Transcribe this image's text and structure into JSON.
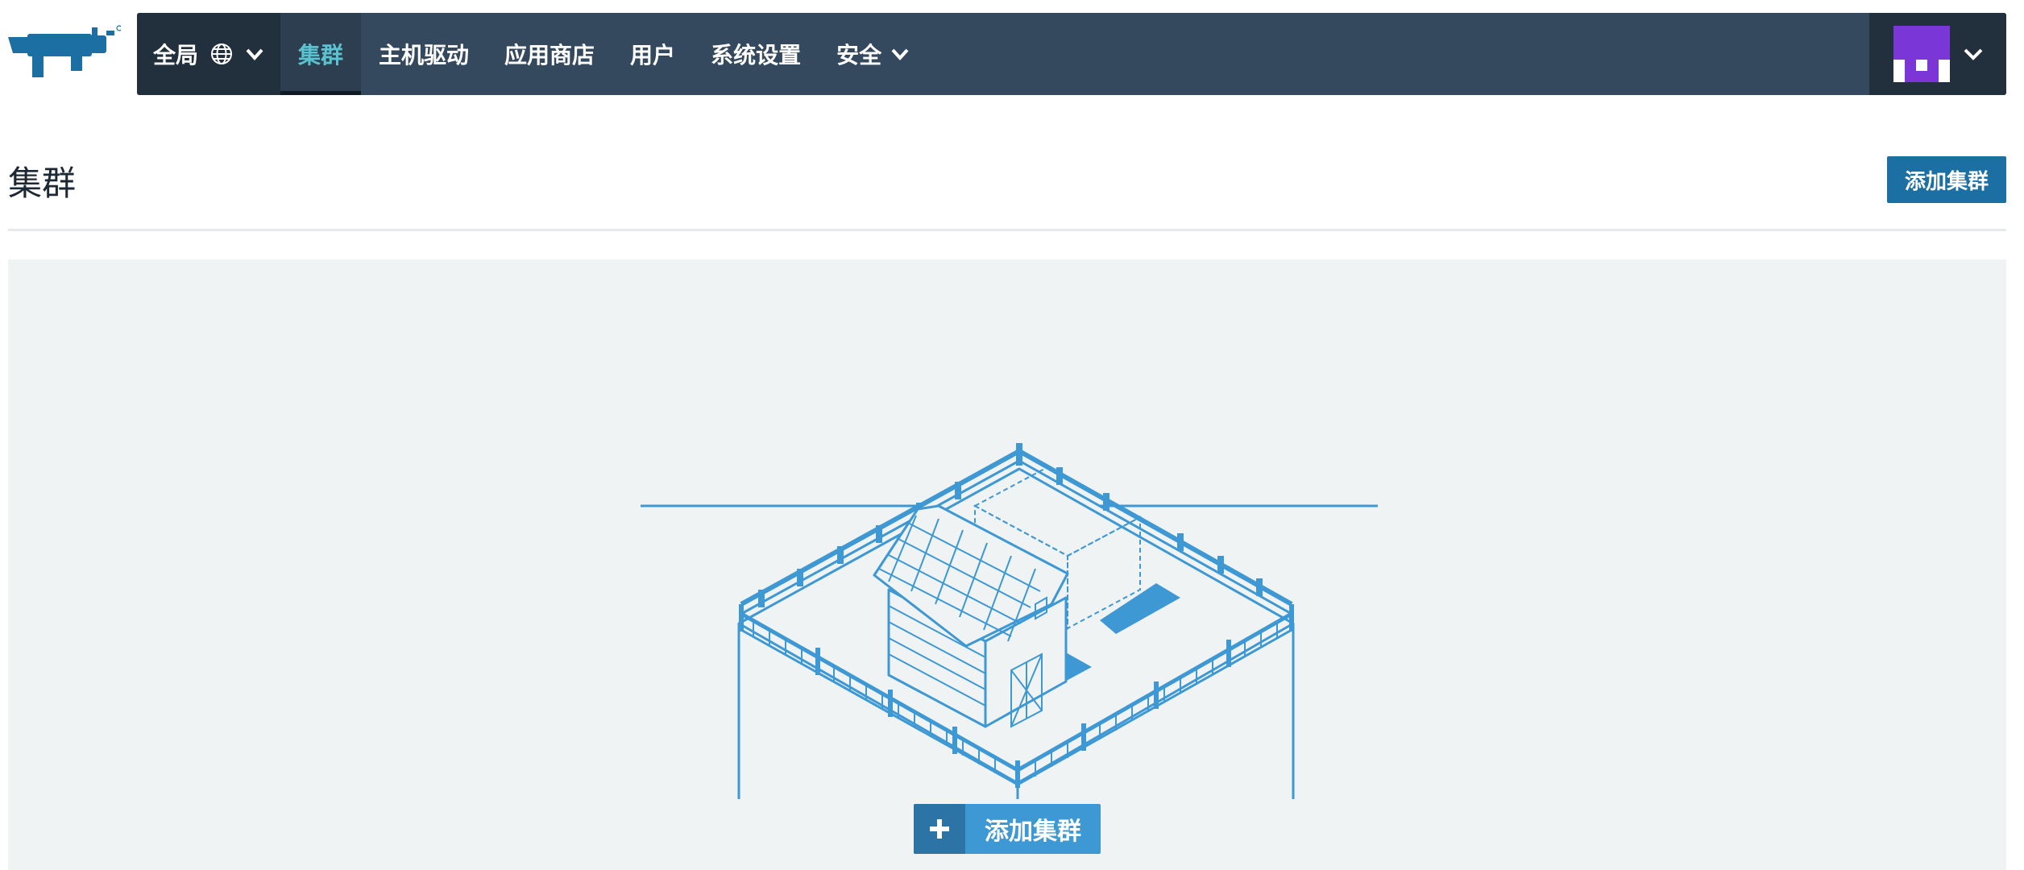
{
  "header": {
    "logo_icon": "rancher-cow-logo",
    "scope": {
      "label": "全局",
      "globe_icon": "globe-icon",
      "chevron_icon": "chevron-down-icon"
    },
    "nav": [
      {
        "label": "集群",
        "active": true
      },
      {
        "label": "主机驱动",
        "active": false
      },
      {
        "label": "应用商店",
        "active": false
      },
      {
        "label": "用户",
        "active": false
      },
      {
        "label": "系统设置",
        "active": false
      },
      {
        "label": "安全",
        "active": false,
        "has_dropdown": true
      }
    ],
    "user": {
      "avatar_icon": "user-avatar",
      "avatar_color": "#7a36d6",
      "chevron_icon": "chevron-down-icon"
    }
  },
  "page": {
    "title": "集群",
    "add_button_label": "添加集群"
  },
  "empty_state": {
    "illustration_icon": "farm-barn-illustration",
    "add_button_label": "添加集群",
    "add_button_icon": "plus-icon"
  },
  "colors": {
    "navbar": "#34495e",
    "navbar_dark": "#22303d",
    "nav_active_text": "#5bc2cf",
    "primary": "#1c6fa3",
    "illustration": "#3d98d3",
    "panel_bg": "#f0f3f4"
  }
}
